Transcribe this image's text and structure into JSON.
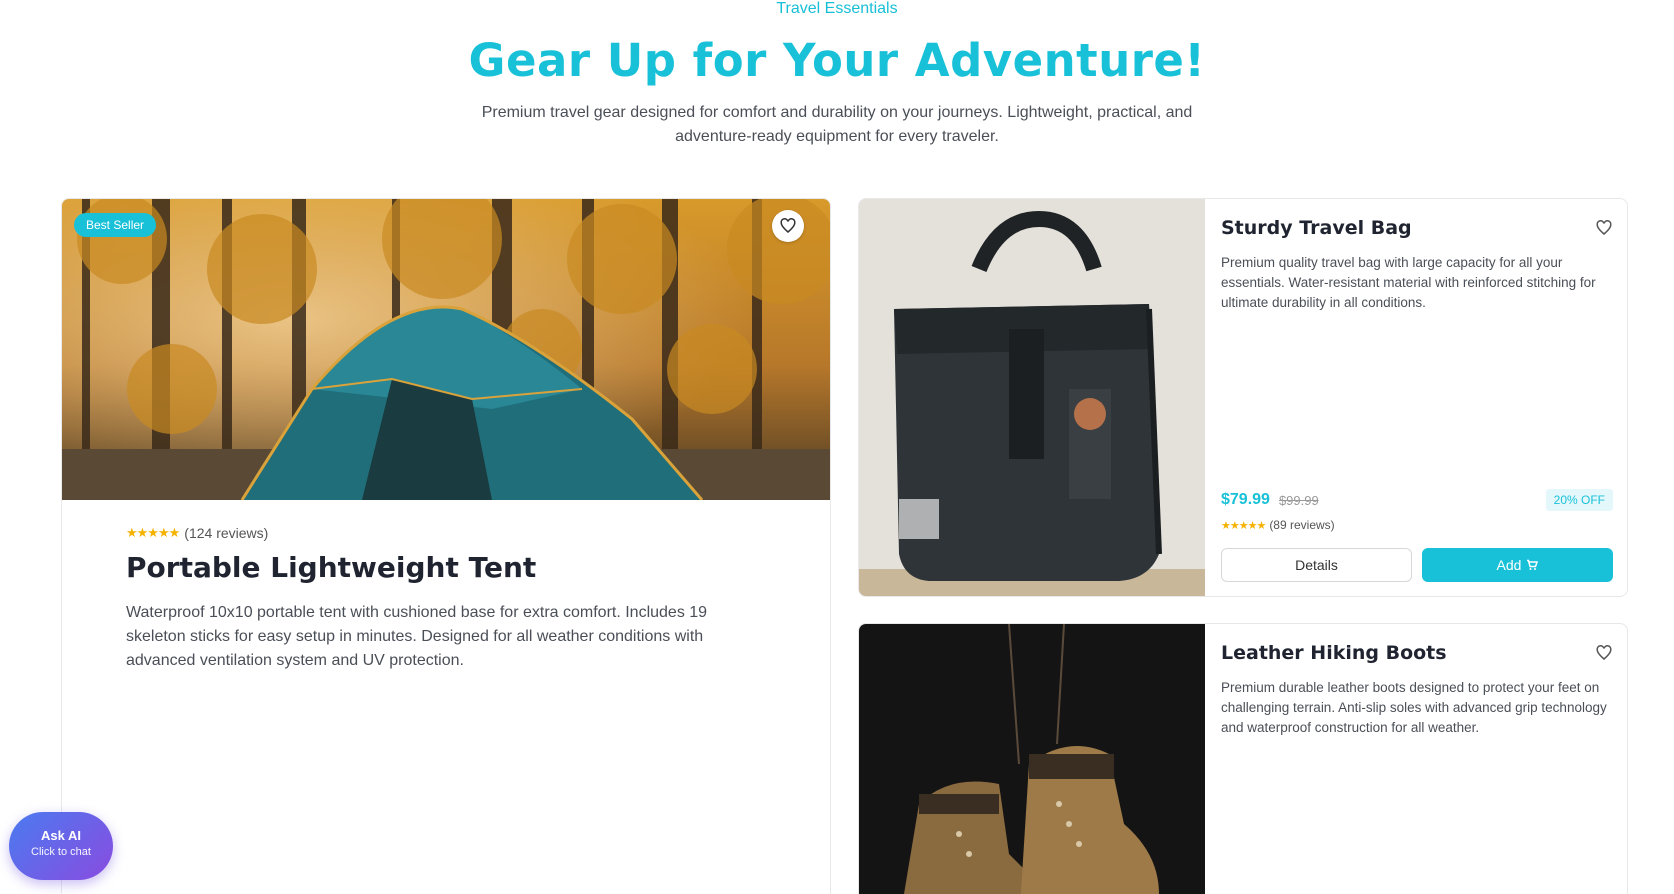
{
  "header": {
    "eyebrow": "Travel Essentials",
    "title": "Gear Up for Your Adventure!",
    "subtitle": "Premium travel gear designed for comfort and durability on your journeys. Lightweight, practical, and adventure-ready equipment for every traveler."
  },
  "featured": {
    "badge": "Best Seller",
    "stars": "★★★★★",
    "reviews": "(124 reviews)",
    "title": "Portable Lightweight Tent",
    "description": "Waterproof 10x10 portable tent with cushioned base for extra comfort. Includes 19 skeleton sticks for easy setup in minutes. Designed for all weather conditions with advanced ventilation system and UV protection.",
    "image_icon": "tent-in-forest-image"
  },
  "products": [
    {
      "title": "Sturdy Travel Bag",
      "description": "Premium quality travel bag with large capacity for all your essentials. Water-resistant material with reinforced stitching for ultimate durability in all conditions.",
      "price": "$79.99",
      "old_price": "$99.99",
      "discount": "20% OFF",
      "stars": "★★★★★",
      "reviews": "(89 reviews)",
      "details_label": "Details",
      "add_label": "Add",
      "image_icon": "backpack-image"
    },
    {
      "title": "Leather Hiking Boots",
      "description": "Premium durable leather boots designed to protect your feet on challenging terrain. Anti-slip soles with advanced grip technology and waterproof construction for all weather.",
      "image_icon": "hiking-boots-image"
    }
  ],
  "ask_ai": {
    "title": "Ask AI",
    "subtitle": "Click to chat"
  },
  "colors": {
    "accent": "#19c1d8",
    "star": "#f5b301",
    "ask_ai_start": "#4a7bf0",
    "ask_ai_end": "#8a4be0"
  },
  "icons": [
    "heart-icon",
    "cart-icon",
    "star-icon"
  ]
}
